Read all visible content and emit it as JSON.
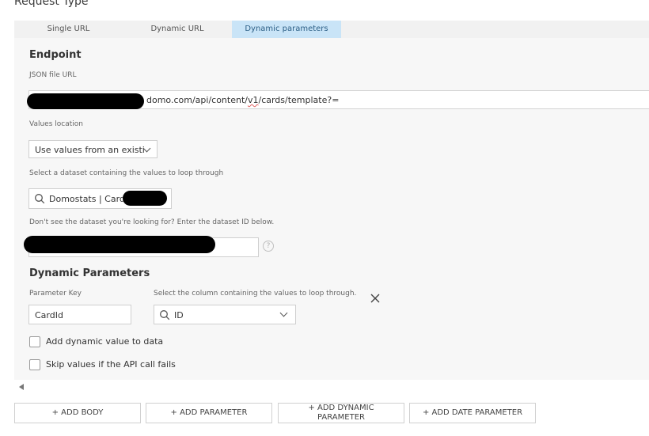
{
  "section": {
    "title": "Request Type"
  },
  "tabs": [
    {
      "label": "Single URL",
      "active": false
    },
    {
      "label": "Dynamic URL",
      "active": false
    },
    {
      "label": "Dynamic parameters",
      "active": true
    }
  ],
  "endpoint": {
    "heading": "Endpoint",
    "json_url_label": "JSON file URL",
    "json_url_value_prefix": "domo.com/api/content/",
    "json_url_value_squiggle": "v1",
    "json_url_value_suffix": "/cards/template?="
  },
  "values_location": {
    "label": "Values location",
    "selected": "Use values from an existi"
  },
  "dataset": {
    "label": "Select a dataset containing the values to loop through",
    "search_value": "Domostats | Card",
    "missing_label": "Don't see the dataset you're looking for? Enter the dataset ID below.",
    "help_symbol": "?"
  },
  "dynamic_parameters": {
    "heading": "Dynamic Parameters",
    "key_label": "Parameter Key",
    "key_value": "CardId",
    "column_label": "Select the column containing the values to loop through.",
    "column_value": "ID"
  },
  "options": {
    "add_dynamic_value": "Add dynamic value to data",
    "skip_values": "Skip values if the API call fails"
  },
  "buttons": {
    "add_body": "+ ADD BODY",
    "add_parameter": "+ ADD PARAMETER",
    "add_dynamic_parameter": "+ ADD DYNAMIC PARAMETER",
    "add_date_parameter": "+ ADD DATE PARAMETER"
  },
  "colors": {
    "active_tab": "#c9e4f7",
    "panel": "#f7f7f7"
  }
}
